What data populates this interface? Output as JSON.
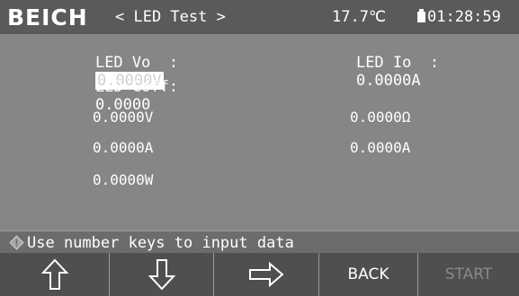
{
  "header": {
    "brand": "BEICH",
    "title": "< LED Test >",
    "temperature": "17.7℃",
    "time": "01:28:59"
  },
  "params": {
    "led_vo_label": "LED Vo  :",
    "led_vo_value": "0.0000V",
    "led_io_label": "LED Io  :",
    "led_io_value": "0.0000A",
    "led_coff_label": "LED Coff:",
    "led_coff_value": "0.0000"
  },
  "readings": {
    "voltage": "0.0000V",
    "resistance": "0.0000Ω",
    "current1": "0.0000A",
    "current2": "0.0000A",
    "power": "0.0000W"
  },
  "status": {
    "message": "Use number keys to input data"
  },
  "softkeys": {
    "up": "up-arrow",
    "down": "down-arrow",
    "right": "right-arrow",
    "back": "BACK",
    "start": "START"
  }
}
